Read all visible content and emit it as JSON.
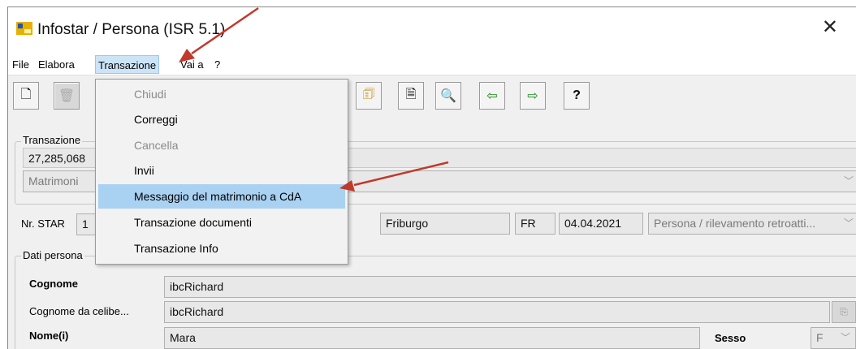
{
  "window": {
    "title": "Infostar / Persona (ISR 5.1)",
    "close_glyph": "✕",
    "icon": "infostar-app-icon"
  },
  "menubar": {
    "items": [
      "File",
      "Elabora",
      "Transazione",
      "Vai a",
      "?"
    ]
  },
  "toolbar": {
    "buttons": [
      {
        "name": "new-document-button",
        "icon": "🗋"
      },
      {
        "name": "delete-button",
        "icon": "🗑"
      },
      {
        "name": "document-yellow-button",
        "icon": "🗊"
      },
      {
        "name": "document-button",
        "icon": "🗎"
      },
      {
        "name": "document-search-button",
        "icon": "🔍"
      },
      {
        "name": "arrow-left-button",
        "icon": "⇦"
      },
      {
        "name": "arrow-right-button",
        "icon": "⇨"
      },
      {
        "name": "help-button",
        "icon": "?"
      }
    ]
  },
  "transazione_panel": {
    "legend": "Transazione",
    "number": "27,285,068",
    "type": "Matrimoni"
  },
  "star_row": {
    "label": "Nr. STAR",
    "value": "1",
    "place": "Friburgo",
    "canton": "FR",
    "date": "04.04.2021",
    "mode": "Persona / rilevamento retroatti..."
  },
  "dati_personali": {
    "legend": "Dati persona",
    "cognome_label": "Cognome",
    "cognome": "ibcRichard",
    "celibe_label": "Cognome da celibe...",
    "celibe": "ibcRichard",
    "nome_label": "Nome(i)",
    "nome": "Mara",
    "sesso_label": "Sesso",
    "sesso": "F"
  },
  "dropdown": {
    "items": [
      {
        "label": "Chiudi",
        "enabled": false
      },
      {
        "label": "Correggi",
        "enabled": true
      },
      {
        "label": "Cancella",
        "enabled": false
      },
      {
        "label": "Invii",
        "enabled": true
      },
      {
        "label": "Messaggio del matrimonio a CdA",
        "enabled": true,
        "highlighted": true
      },
      {
        "label": "Transazione documenti",
        "enabled": true
      },
      {
        "label": "Transazione Info",
        "enabled": true
      }
    ]
  },
  "colors": {
    "annotation_arrow": "#c0392b",
    "menu_highlight": "#a9d1f2"
  }
}
